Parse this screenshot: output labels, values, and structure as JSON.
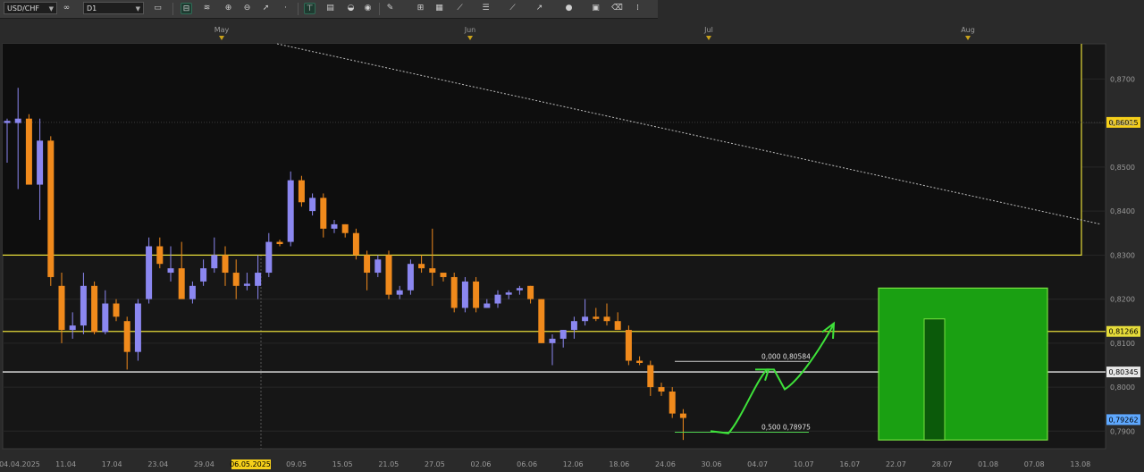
{
  "toolbar": {
    "symbol": "USD/CHF",
    "timeframe": "D1",
    "icons": [
      "link-icon",
      "chart-type-icon",
      "layout-icon",
      "indicator-icon",
      "zoom-in-icon",
      "zoom-out-icon",
      "cursor-icon",
      "dot-icon",
      "vertical-line-icon",
      "text-icon",
      "palette-icon",
      "pencil-icon",
      "trade-icon",
      "grid-icon",
      "eraser-line-icon",
      "channel-icon",
      "fib-icon",
      "arrow-icon",
      "circle-icon",
      "template-icon",
      "delete-icon",
      "more-icon"
    ]
  },
  "colors": {
    "background": "#161616",
    "up": "#8b87f0",
    "down": "#f08a1c",
    "rect_border": "#e6dc3a",
    "green_fill": "#1aa012",
    "green_border": "#77e040",
    "price_tag_yellow": "#f5cf1a",
    "price_tag_blue": "#5ea8ff",
    "current_tag_text": "#000000"
  },
  "chart_data": {
    "type": "candlestick",
    "symbol": "USD/CHF",
    "timeframe": "D1",
    "ylim": [
      0.786,
      0.878
    ],
    "y_ticks": [
      "0,8700",
      "0,8600",
      "0,8500",
      "0,8400",
      "0,8300",
      "0,8200",
      "0,8100",
      "0,8000",
      "0,7900"
    ],
    "x_tick_labels": [
      "04.04.2025",
      "11.04",
      "17.04",
      "23.04",
      "29.04",
      "06.05.2025",
      "09.05",
      "15.05",
      "21.05",
      "27.05",
      "02.06",
      "06.06",
      "12.06",
      "18.06",
      "24.06",
      "30.06",
      "04.07",
      "10.07",
      "16.07",
      "22.07",
      "28.07",
      "01.08",
      "07.08",
      "13.08"
    ],
    "month_labels": [
      "May",
      "Jun",
      "Jul",
      "Aug"
    ],
    "candles": [
      {
        "o": 0.86,
        "h": 0.861,
        "l": 0.851,
        "c": 0.8605
      },
      {
        "o": 0.86,
        "h": 0.868,
        "l": 0.845,
        "c": 0.861
      },
      {
        "o": 0.861,
        "h": 0.862,
        "l": 0.847,
        "c": 0.846
      },
      {
        "o": 0.846,
        "h": 0.861,
        "l": 0.838,
        "c": 0.856
      },
      {
        "o": 0.856,
        "h": 0.857,
        "l": 0.823,
        "c": 0.825
      },
      {
        "o": 0.823,
        "h": 0.826,
        "l": 0.81,
        "c": 0.813
      },
      {
        "o": 0.813,
        "h": 0.817,
        "l": 0.811,
        "c": 0.814
      },
      {
        "o": 0.814,
        "h": 0.826,
        "l": 0.812,
        "c": 0.823
      },
      {
        "o": 0.823,
        "h": 0.824,
        "l": 0.812,
        "c": 0.8125
      },
      {
        "o": 0.8125,
        "h": 0.822,
        "l": 0.812,
        "c": 0.819
      },
      {
        "o": 0.819,
        "h": 0.82,
        "l": 0.815,
        "c": 0.816
      },
      {
        "o": 0.815,
        "h": 0.816,
        "l": 0.804,
        "c": 0.808
      },
      {
        "o": 0.808,
        "h": 0.82,
        "l": 0.806,
        "c": 0.819
      },
      {
        "o": 0.82,
        "h": 0.834,
        "l": 0.819,
        "c": 0.832
      },
      {
        "o": 0.832,
        "h": 0.834,
        "l": 0.827,
        "c": 0.828
      },
      {
        "o": 0.826,
        "h": 0.832,
        "l": 0.824,
        "c": 0.827
      },
      {
        "o": 0.827,
        "h": 0.833,
        "l": 0.823,
        "c": 0.82
      },
      {
        "o": 0.82,
        "h": 0.824,
        "l": 0.819,
        "c": 0.823
      },
      {
        "o": 0.824,
        "h": 0.829,
        "l": 0.823,
        "c": 0.827
      },
      {
        "o": 0.827,
        "h": 0.834,
        "l": 0.826,
        "c": 0.83
      },
      {
        "o": 0.83,
        "h": 0.832,
        "l": 0.823,
        "c": 0.826
      },
      {
        "o": 0.826,
        "h": 0.829,
        "l": 0.82,
        "c": 0.823
      },
      {
        "o": 0.823,
        "h": 0.826,
        "l": 0.822,
        "c": 0.8235
      },
      {
        "o": 0.823,
        "h": 0.83,
        "l": 0.82,
        "c": 0.826
      },
      {
        "o": 0.826,
        "h": 0.835,
        "l": 0.825,
        "c": 0.833
      },
      {
        "o": 0.833,
        "h": 0.8335,
        "l": 0.832,
        "c": 0.8325
      },
      {
        "o": 0.833,
        "h": 0.849,
        "l": 0.832,
        "c": 0.847
      },
      {
        "o": 0.847,
        "h": 0.848,
        "l": 0.841,
        "c": 0.842
      },
      {
        "o": 0.84,
        "h": 0.844,
        "l": 0.839,
        "c": 0.843
      },
      {
        "o": 0.843,
        "h": 0.844,
        "l": 0.834,
        "c": 0.836
      },
      {
        "o": 0.836,
        "h": 0.838,
        "l": 0.835,
        "c": 0.837
      },
      {
        "o": 0.837,
        "h": 0.837,
        "l": 0.834,
        "c": 0.835
      },
      {
        "o": 0.835,
        "h": 0.836,
        "l": 0.829,
        "c": 0.83
      },
      {
        "o": 0.83,
        "h": 0.831,
        "l": 0.822,
        "c": 0.826
      },
      {
        "o": 0.826,
        "h": 0.83,
        "l": 0.825,
        "c": 0.829
      },
      {
        "o": 0.83,
        "h": 0.831,
        "l": 0.82,
        "c": 0.821
      },
      {
        "o": 0.821,
        "h": 0.823,
        "l": 0.82,
        "c": 0.822
      },
      {
        "o": 0.822,
        "h": 0.829,
        "l": 0.821,
        "c": 0.828
      },
      {
        "o": 0.828,
        "h": 0.83,
        "l": 0.826,
        "c": 0.827
      },
      {
        "o": 0.827,
        "h": 0.836,
        "l": 0.823,
        "c": 0.826
      },
      {
        "o": 0.826,
        "h": 0.825,
        "l": 0.824,
        "c": 0.825
      },
      {
        "o": 0.825,
        "h": 0.826,
        "l": 0.817,
        "c": 0.818
      },
      {
        "o": 0.818,
        "h": 0.825,
        "l": 0.817,
        "c": 0.824
      },
      {
        "o": 0.824,
        "h": 0.825,
        "l": 0.817,
        "c": 0.818
      },
      {
        "o": 0.818,
        "h": 0.82,
        "l": 0.818,
        "c": 0.819
      },
      {
        "o": 0.819,
        "h": 0.822,
        "l": 0.818,
        "c": 0.821
      },
      {
        "o": 0.821,
        "h": 0.822,
        "l": 0.82,
        "c": 0.8215
      },
      {
        "o": 0.822,
        "h": 0.823,
        "l": 0.821,
        "c": 0.8225
      },
      {
        "o": 0.823,
        "h": 0.823,
        "l": 0.819,
        "c": 0.82
      },
      {
        "o": 0.82,
        "h": 0.82,
        "l": 0.81,
        "c": 0.81
      },
      {
        "o": 0.81,
        "h": 0.812,
        "l": 0.805,
        "c": 0.811
      },
      {
        "o": 0.811,
        "h": 0.813,
        "l": 0.809,
        "c": 0.813
      },
      {
        "o": 0.813,
        "h": 0.816,
        "l": 0.811,
        "c": 0.815
      },
      {
        "o": 0.815,
        "h": 0.82,
        "l": 0.814,
        "c": 0.816
      },
      {
        "o": 0.816,
        "h": 0.818,
        "l": 0.815,
        "c": 0.8155
      },
      {
        "o": 0.816,
        "h": 0.819,
        "l": 0.814,
        "c": 0.815
      },
      {
        "o": 0.815,
        "h": 0.817,
        "l": 0.813,
        "c": 0.813
      },
      {
        "o": 0.813,
        "h": 0.814,
        "l": 0.805,
        "c": 0.806
      },
      {
        "o": 0.806,
        "h": 0.807,
        "l": 0.805,
        "c": 0.8055
      },
      {
        "o": 0.805,
        "h": 0.806,
        "l": 0.798,
        "c": 0.8
      },
      {
        "o": 0.8,
        "h": 0.801,
        "l": 0.798,
        "c": 0.799
      },
      {
        "o": 0.799,
        "h": 0.8,
        "l": 0.793,
        "c": 0.794
      },
      {
        "o": 0.794,
        "h": 0.795,
        "l": 0.788,
        "c": 0.793
      }
    ],
    "horizontal_lines": [
      {
        "price": 0.81266,
        "color": "#e6dc3a",
        "label": "0,81266"
      },
      {
        "price": 0.80345,
        "color": "#e8e8e8",
        "label": "0,80345"
      }
    ],
    "price_tags": [
      {
        "price": 0.86015,
        "label": "0,86015",
        "style": "yellow"
      },
      {
        "price": 0.79262,
        "label": "0,79262",
        "style": "blue"
      }
    ],
    "trendline": {
      "from": [
        310,
        0.878
      ],
      "to": [
        1232,
        0.837
      ]
    },
    "range_box": {
      "x1": 0,
      "x2": 1210,
      "top": 0.878,
      "bottom": 0.83
    },
    "fib_levels": [
      {
        "label": "0,000 0,80584",
        "price": 0.80584,
        "x1": 755,
        "x2": 905
      },
      {
        "label": "0,500 0,78975",
        "price": 0.78975,
        "x1": 755,
        "x2": 905
      }
    ],
    "green_box": {
      "x1": 983,
      "x2": 1172,
      "top": 0.8225,
      "bottom": 0.788
    },
    "green_bar": {
      "x1": 1034,
      "x2": 1057,
      "top": 0.8155,
      "bottom": 0.788
    },
    "highlight_date": "06.05.2025"
  }
}
